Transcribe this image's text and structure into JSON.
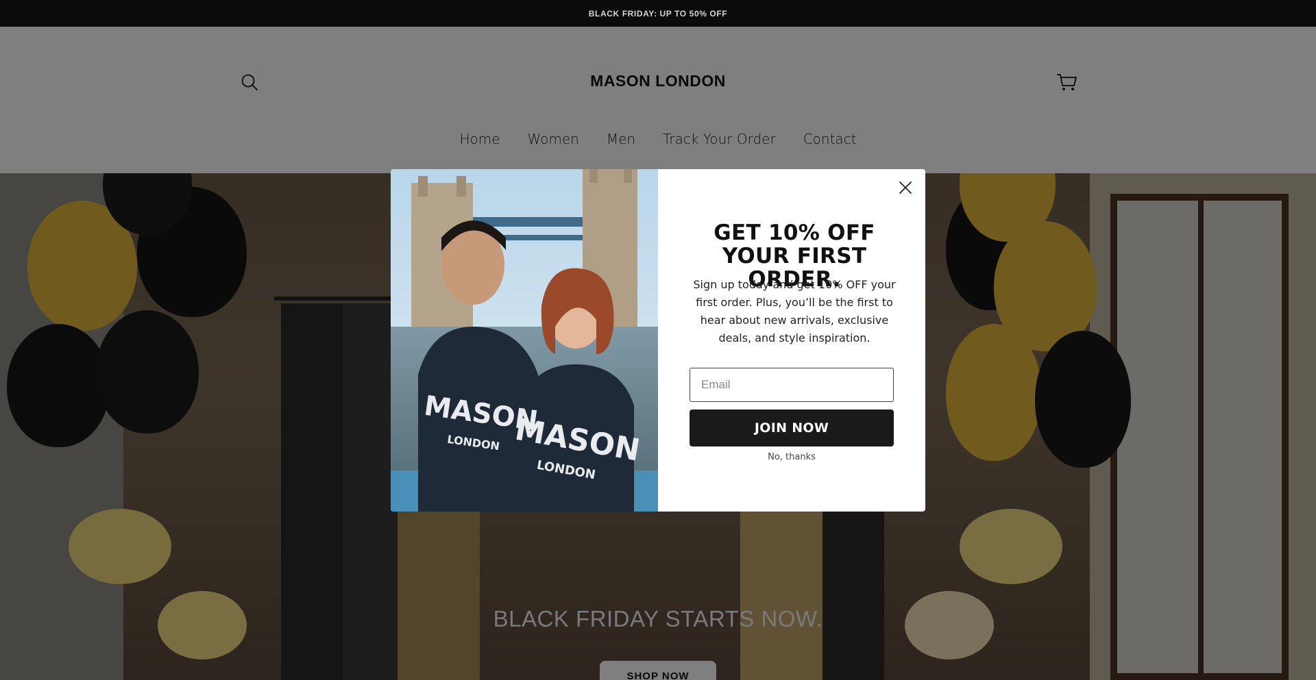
{
  "announcement": {
    "text": "BLACK FRIDAY: UP TO 50% OFF"
  },
  "header": {
    "logo": "MASON LONDON",
    "search_icon": "search-icon",
    "cart_icon": "cart-icon",
    "nav": [
      {
        "label": "Home"
      },
      {
        "label": "Women"
      },
      {
        "label": "Men"
      },
      {
        "label": "Track Your Order"
      },
      {
        "label": "Contact"
      }
    ]
  },
  "hero": {
    "title": "BLACK FRIDAY STARTS NOW.",
    "button_label": "SHOP NOW"
  },
  "popup": {
    "title": "GET 10% OFF YOUR FIRST ORDER.",
    "description": "Sign up today and get 10% OFF your first order. Plus, you’ll be the first to hear about new arrivals, exclusive deals, and style inspiration.",
    "email_placeholder": "Email",
    "submit_label": "JOIN NOW",
    "dismiss_label": "No, thanks",
    "close_icon": "close-icon",
    "image_hoodie_text_1": "MASON",
    "image_hoodie_text_2": "LONDON"
  },
  "colors": {
    "announcement_bg": "#0b0b0b",
    "button_dark": "#1a1a1a",
    "balloon_gold": "#e0b53a",
    "balloon_black": "#141414"
  }
}
